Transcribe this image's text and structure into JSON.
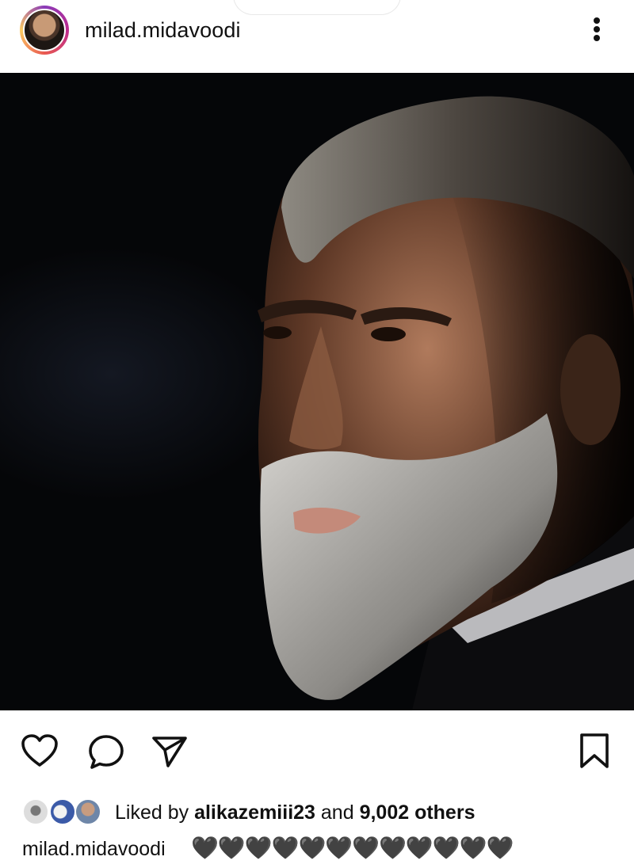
{
  "post": {
    "username": "milad.midavoodi",
    "icons": {
      "more": "more-vertical-icon",
      "like": "heart-icon",
      "comment": "comment-icon",
      "share": "send-icon",
      "save": "bookmark-icon"
    },
    "likes": {
      "prefix": "Liked by ",
      "liker": "alikazemiii23",
      "middle": " and ",
      "count": "9,002 others"
    },
    "caption": {
      "username": "milad.midavoodi",
      "text": "🖤🖤🖤🖤🖤🖤🖤🖤🖤🖤🖤🖤"
    }
  },
  "colors": {
    "background": "#ffffff",
    "text": "#111111",
    "photo_background": "#050608",
    "story_ring": "#bc2a8d"
  }
}
